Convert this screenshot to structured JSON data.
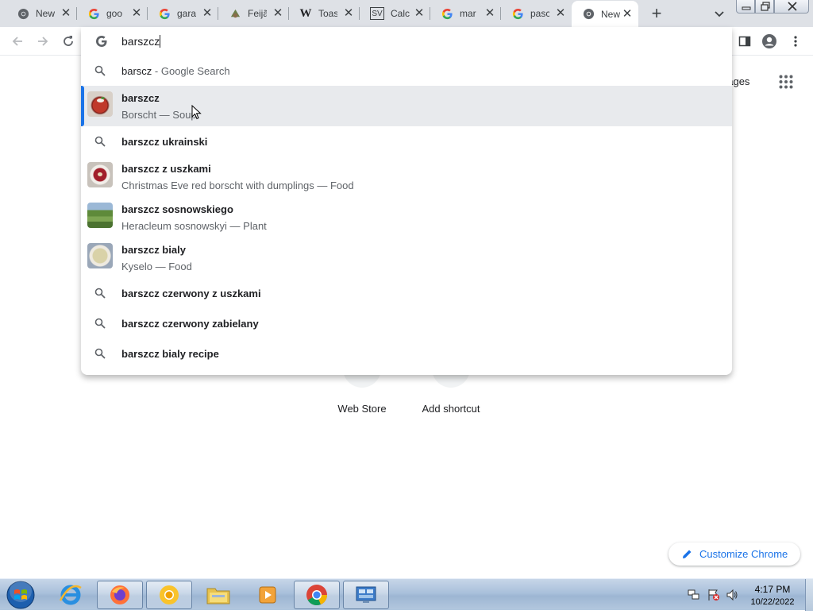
{
  "tabs": [
    {
      "title": "New",
      "icon": "chrome-icon"
    },
    {
      "title": "goo",
      "icon": "google-icon"
    },
    {
      "title": "gara",
      "icon": "google-icon"
    },
    {
      "title": "Feijã",
      "icon": "feijoada-icon"
    },
    {
      "title": "Toas",
      "icon": "wikipedia-icon"
    },
    {
      "title": "Calc",
      "icon": "sv-icon"
    },
    {
      "title": "mar",
      "icon": "google-icon"
    },
    {
      "title": "pasc",
      "icon": "google-icon"
    },
    {
      "title": "New",
      "icon": "chrome-icon",
      "active": true
    }
  ],
  "omnibox": {
    "text": "barszcz"
  },
  "suggestions": [
    {
      "type": "search",
      "main": "barscz",
      "light": " - Google Search"
    },
    {
      "type": "entity",
      "main": "barszcz",
      "sub": "Borscht — Soup",
      "selected": true
    },
    {
      "type": "search",
      "main": "barszcz ukrainski"
    },
    {
      "type": "entity",
      "main": "barszcz z uszkami",
      "sub": "Christmas Eve red borscht with dumplings — Food"
    },
    {
      "type": "entity",
      "main": "barszcz sosnowskiego",
      "sub": "Heracleum sosnowskyi — Plant"
    },
    {
      "type": "entity",
      "main": "barszcz bialy",
      "sub": "Kyselo — Food"
    },
    {
      "type": "search",
      "main": "barszcz czerwony z uszkami"
    },
    {
      "type": "search",
      "main": "barszcz czerwony zabielany"
    },
    {
      "type": "search",
      "main": "barszcz bialy recipe"
    }
  ],
  "ntp": {
    "images_link": "nages",
    "shortcuts": [
      {
        "label": "Web Store"
      },
      {
        "label": "Add shortcut"
      }
    ],
    "customize_label": "Customize Chrome"
  },
  "taskbar": {
    "time": "4:17 PM",
    "date": "10/22/2022"
  },
  "colors": {
    "accent": "#1a73e8",
    "selected_row": "#e8eaed",
    "tabstrip": "#dee1e6"
  }
}
